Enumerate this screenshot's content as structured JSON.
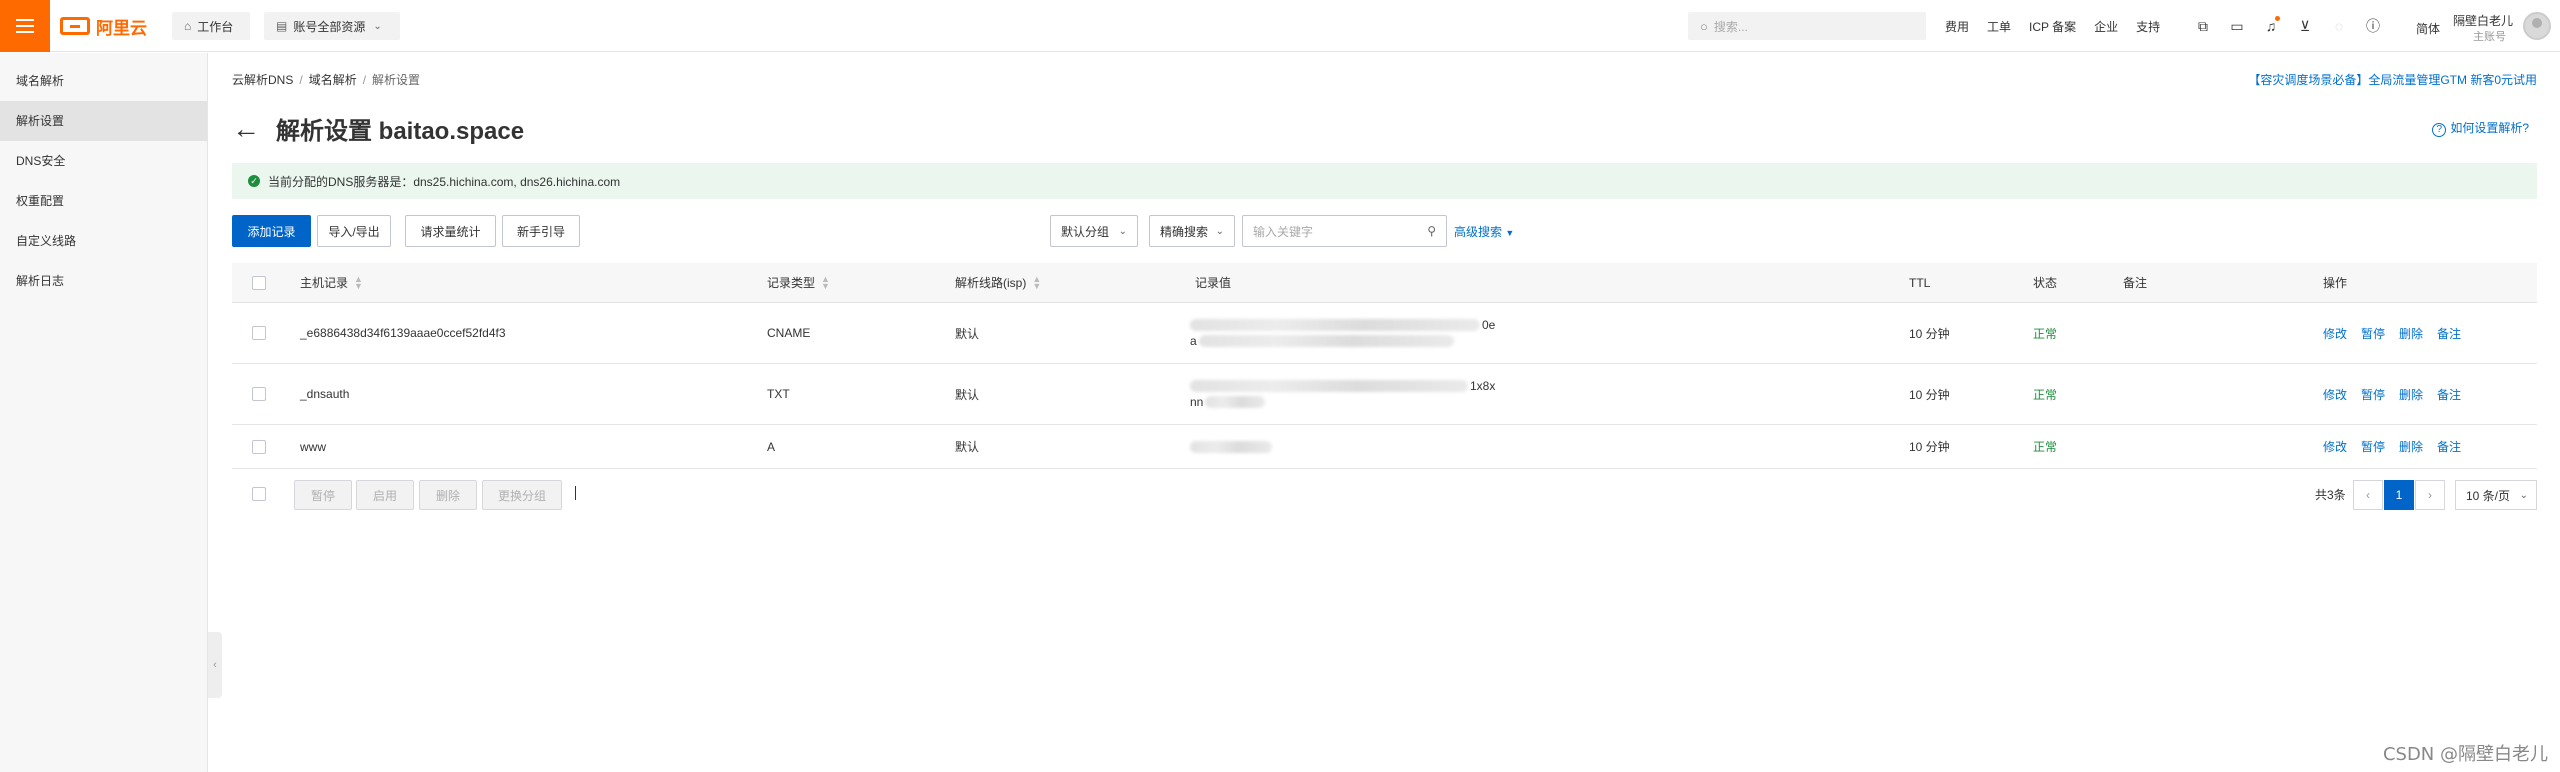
{
  "topbar": {
    "brand": "阿里云",
    "workbench": "工作台",
    "resources": "账号全部资源",
    "search_placeholder": "搜索...",
    "links": [
      "费用",
      "工单",
      "ICP 备案",
      "企业",
      "支持"
    ],
    "icons": [
      "cloud-shell-icon",
      "terminal-icon",
      "notification-bell-icon",
      "cart-icon",
      "lightbulb-icon",
      "help-icon"
    ],
    "lang": "简体",
    "user_name": "隔壁白老儿",
    "user_role": "主账号"
  },
  "sidebar": {
    "items": [
      {
        "label": "域名解析",
        "active": false
      },
      {
        "label": "解析设置",
        "active": true
      },
      {
        "label": "DNS安全",
        "active": false
      },
      {
        "label": "权重配置",
        "active": false
      },
      {
        "label": "自定义线路",
        "active": false
      },
      {
        "label": "解析日志",
        "active": false
      }
    ]
  },
  "breadcrumb": [
    "云解析DNS",
    "域名解析",
    "解析设置"
  ],
  "promo": "【容灾调度场景必备】全局流量管理GTM 新客0元试用",
  "page_title": "解析设置 baitao.space",
  "help_link": "如何设置解析?",
  "notice": "当前分配的DNS服务器是：dns25.hichina.com, dns26.hichina.com",
  "toolbar": {
    "add": "添加记录",
    "import_export": "导入/导出",
    "stats": "请求量统计",
    "guide": "新手引导",
    "group_select": "默认分组",
    "search_mode": "精确搜索",
    "keyword_placeholder": "输入关键字",
    "advanced": "高级搜索"
  },
  "table": {
    "headers": {
      "host": "主机记录",
      "type": "记录类型",
      "line": "解析线路(isp)",
      "value": "记录值",
      "ttl": "TTL",
      "status": "状态",
      "remark": "备注",
      "ops": "操作"
    },
    "rows": [
      {
        "host": "_e6886438d34f6139aaae0ccef52fd4f3",
        "type": "CNAME",
        "line": "默认",
        "value_fragment_1": "0e",
        "value_fragment_2": "a",
        "ttl": "10 分钟",
        "status": "正常"
      },
      {
        "host": "_dnsauth",
        "type": "TXT",
        "line": "默认",
        "value_fragment_1": "1x8x",
        "value_fragment_2": "nn",
        "ttl": "10 分钟",
        "status": "正常"
      },
      {
        "host": "www",
        "type": "A",
        "line": "默认",
        "value_fragment_1": "",
        "value_fragment_2": "",
        "ttl": "10 分钟",
        "status": "正常"
      }
    ],
    "actions": [
      "修改",
      "暂停",
      "删除",
      "备注"
    ]
  },
  "footer": {
    "bulk": [
      "暂停",
      "启用",
      "删除",
      "更换分组"
    ],
    "total": "共3条",
    "page": "1",
    "page_size": "10 条/页"
  },
  "watermark": "CSDN @隔壁白老儿"
}
